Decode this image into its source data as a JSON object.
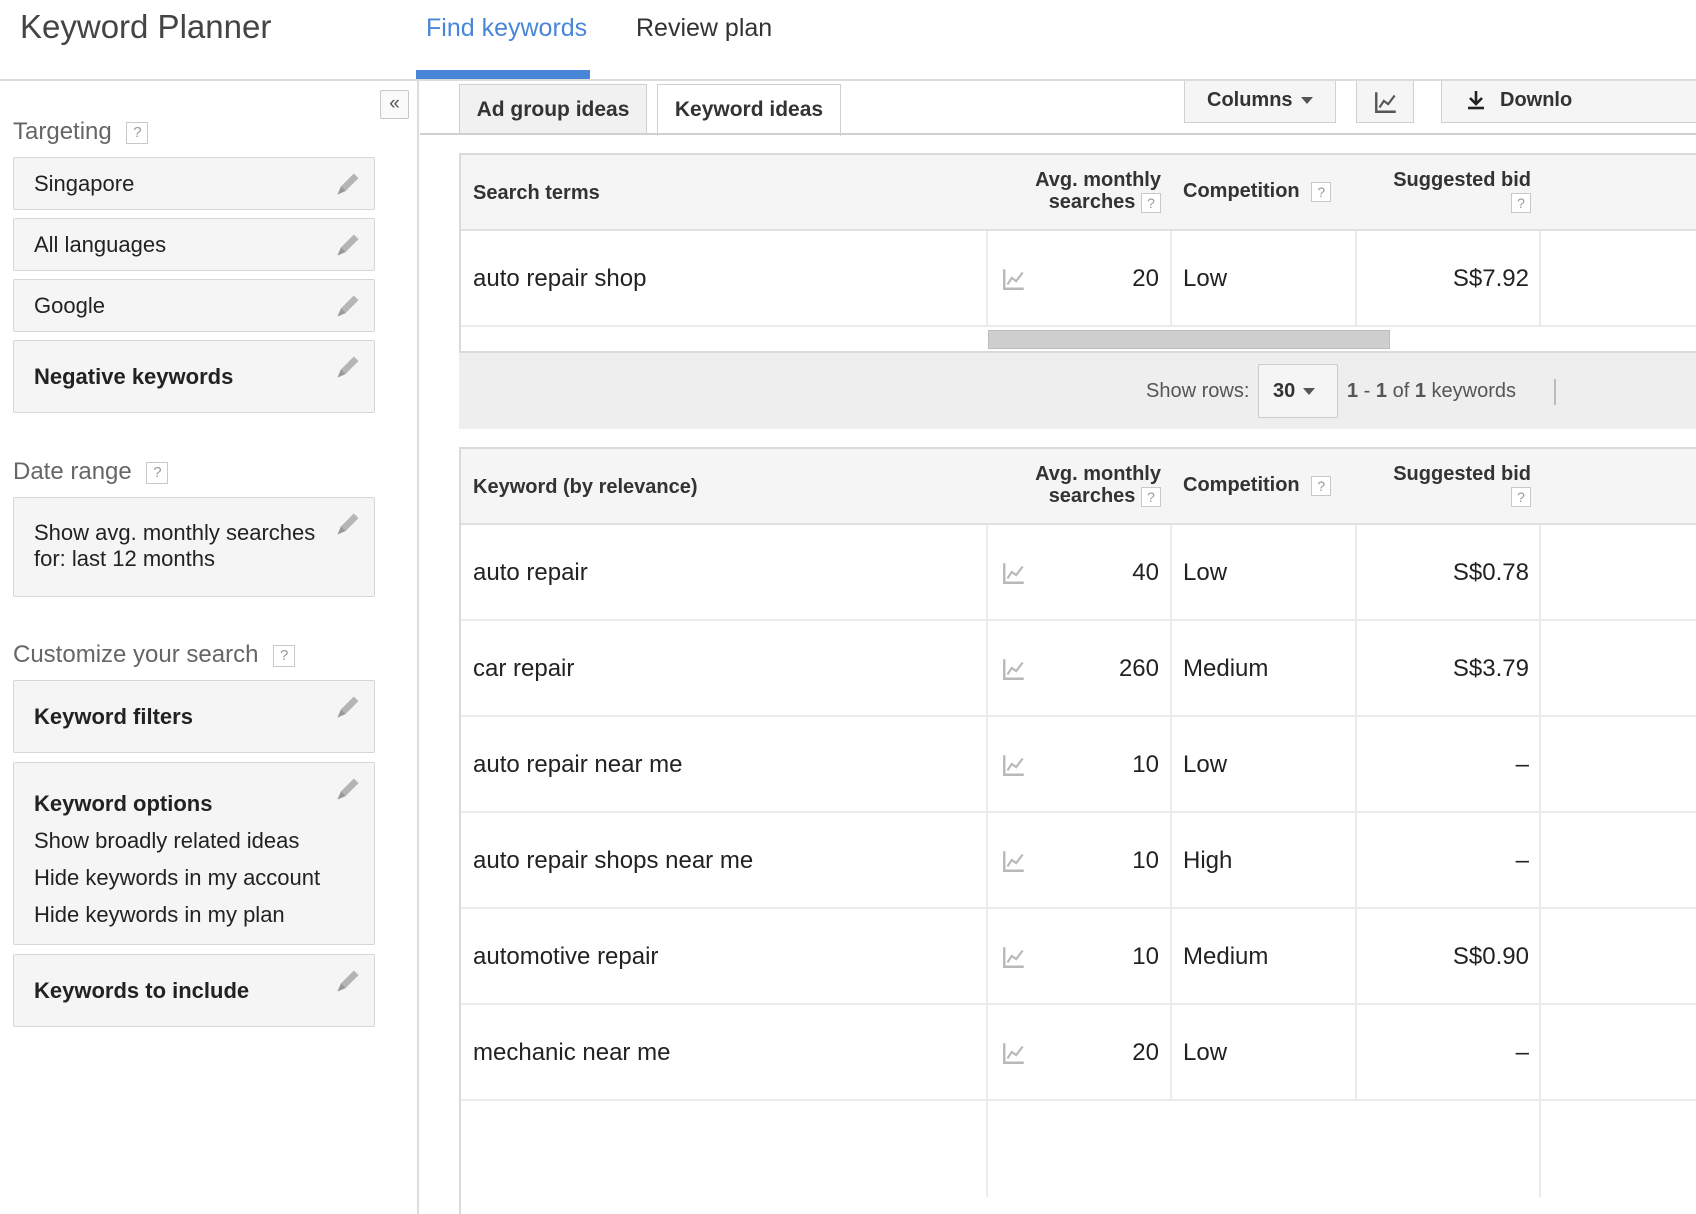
{
  "header": {
    "app_title": "Keyword Planner",
    "tabs": [
      {
        "label": "Find keywords",
        "active": true
      },
      {
        "label": "Review plan",
        "active": false
      }
    ]
  },
  "sidebar": {
    "collapse_glyph": "«",
    "targeting_label": "Targeting",
    "targeting_items": [
      "Singapore",
      "All languages",
      "Google",
      "Negative keywords"
    ],
    "date_range_label": "Date range",
    "date_range_value": "Show avg. monthly searches for: last 12 months",
    "customize_label": "Customize your search",
    "keyword_filters": "Keyword filters",
    "keyword_options": {
      "title": "Keyword options",
      "lines": [
        "Show broadly related ideas",
        "Hide keywords in my account",
        "Hide keywords in my plan"
      ]
    },
    "keywords_to_include": "Keywords to include",
    "help_glyph": "?"
  },
  "content": {
    "subtabs": [
      {
        "label": "Ad group ideas",
        "active": false
      },
      {
        "label": "Keyword ideas",
        "active": true
      }
    ],
    "toolbar": {
      "columns_label": "Columns",
      "download_label": "Downlo"
    },
    "search_terms_table": {
      "headers": {
        "term": "Search terms",
        "avg_line1": "Avg. monthly",
        "avg_line2": "searches",
        "competition": "Competition",
        "bid": "Suggested bid"
      },
      "rows": [
        {
          "term": "auto repair shop",
          "avg": "20",
          "competition": "Low",
          "bid": "S$7.92"
        }
      ]
    },
    "pager": {
      "show_rows_label": "Show rows:",
      "rows_value": "30",
      "range_start": "1",
      "range_sep": " - ",
      "range_end": "1",
      "of_word": " of ",
      "total": "1",
      "suffix": " keywords"
    },
    "keyword_table": {
      "headers": {
        "term": "Keyword (by relevance)",
        "avg_line1": "Avg. monthly",
        "avg_line2": "searches",
        "competition": "Competition",
        "bid": "Suggested bid"
      },
      "rows": [
        {
          "term": "auto repair",
          "avg": "40",
          "competition": "Low",
          "bid": "S$0.78"
        },
        {
          "term": "car repair",
          "avg": "260",
          "competition": "Medium",
          "bid": "S$3.79"
        },
        {
          "term": "auto repair near me",
          "avg": "10",
          "competition": "Low",
          "bid": "–"
        },
        {
          "term": "auto repair shops near me",
          "avg": "10",
          "competition": "High",
          "bid": "–"
        },
        {
          "term": "automotive repair",
          "avg": "10",
          "competition": "Medium",
          "bid": "S$0.90"
        },
        {
          "term": "mechanic near me",
          "avg": "20",
          "competition": "Low",
          "bid": "–"
        }
      ]
    }
  },
  "colors": {
    "accent": "#4a86d8",
    "panel_bg": "#f5f5f5",
    "border": "#d6d6d6"
  }
}
